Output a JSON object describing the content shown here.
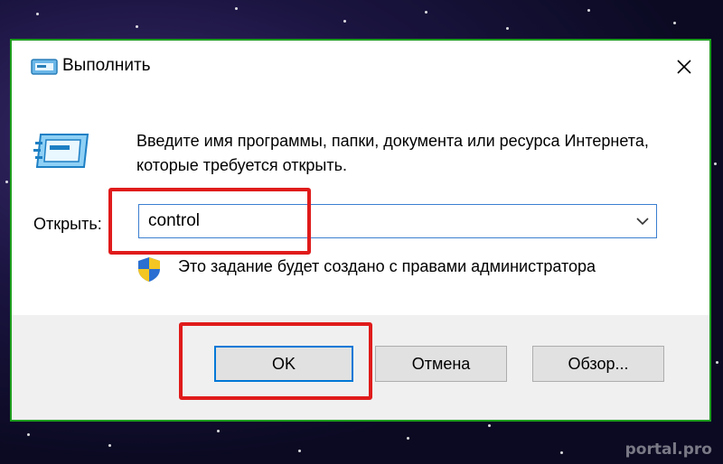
{
  "window": {
    "title": "Выполнить",
    "close_label": "✕"
  },
  "content": {
    "description": "Введите имя программы, папки, документа или ресурса Интернета, которые требуется открыть.",
    "open_label": "Открыть:",
    "input_value": "control",
    "admin_note": "Это задание будет создано с правами администратора"
  },
  "buttons": {
    "ok_label": "OK",
    "cancel_label": "Отмена",
    "browse_label": "Обзор..."
  },
  "watermark": "portal.pro",
  "colors": {
    "highlight": "#e01b1b",
    "dialog_border": "#1e9e1e",
    "focus_blue": "#0078d7"
  },
  "icons": {
    "title": "run-dialog-icon",
    "main": "run-program-icon",
    "shield": "uac-shield-icon",
    "dropdown": "chevron-down-icon",
    "close": "close-icon"
  }
}
